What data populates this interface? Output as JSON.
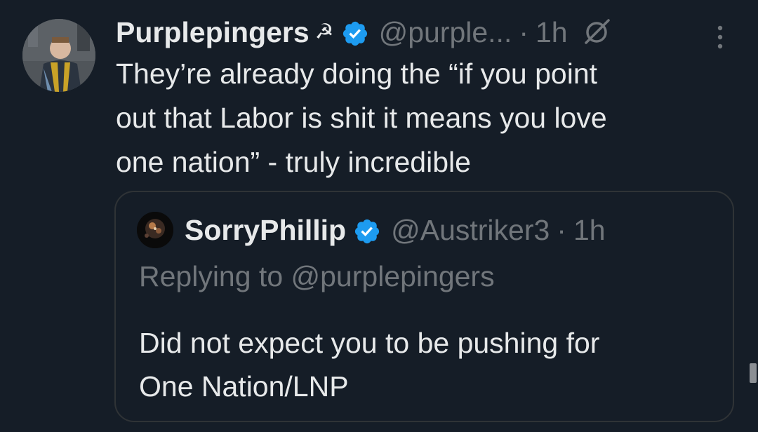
{
  "tweet": {
    "author": {
      "display_name": "Purplepingers",
      "name_emoji": "☭",
      "handle": "@purple...",
      "verified": true
    },
    "separator": "·",
    "time": "1h",
    "edited_icon": "edit-slash-icon",
    "more_icon": "more-vertical-icon",
    "text_lines": [
      "They’re already doing the “if you point",
      "out that Labor is shit it means you love",
      "one nation” - truly incredible"
    ]
  },
  "quote": {
    "author": {
      "display_name": "SorryPhillip",
      "handle": "@Austriker3",
      "verified": true
    },
    "separator": "·",
    "time": "1h",
    "replying_to": "Replying to @purplepingers",
    "text_lines": [
      "Did not expect you to be pushing for",
      "One Nation/LNP"
    ]
  },
  "colors": {
    "background": "#151d27",
    "text": "#e7e9ea",
    "muted": "#71767b",
    "verified": "#1d9bf0",
    "border": "#2f3336"
  }
}
